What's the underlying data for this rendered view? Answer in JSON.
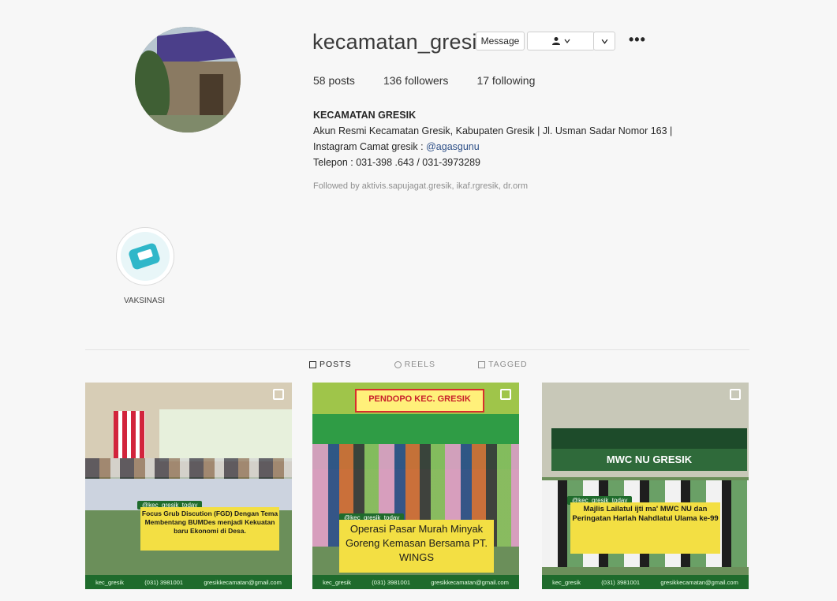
{
  "profile": {
    "username": "kecamatan_gresik",
    "message_label": "Message",
    "follow_icon": "person-icon",
    "more_label": "•••",
    "stats": {
      "posts": "58 posts",
      "followers": "136 followers",
      "following": "17 following"
    },
    "bio": {
      "name": "KECAMATAN GRESIK",
      "line1": "Akun Resmi Kecamatan Gresik, Kabupaten Gresik | Jl. Usman Sadar Nomor 163 |",
      "line2_prefix": "Instagram Camat gresik : ",
      "line2_link": "@agasgunu",
      "line3": "Telepon : 031-398 .643 / 031-3973289"
    },
    "followed_by": "Followed by aktivis.sapujagat.gresik, ikaf.rgresik, dr.orm"
  },
  "highlights": [
    {
      "label": "VAKSINASI"
    }
  ],
  "tabs": [
    {
      "label": "POSTS",
      "icon": "grid-icon",
      "active": true
    },
    {
      "label": "REELS",
      "icon": "reels-icon",
      "active": false
    },
    {
      "label": "TAGGED",
      "icon": "tag-icon",
      "active": false
    }
  ],
  "posts": [
    {
      "tag": "@kec_gresik_today",
      "caption": "Focus Grub Discution (FGD) Dengan Tema Membentang BUMDes menjadi Kekuatan baru Ekonomi di Desa.",
      "footer": [
        "kec_gresik",
        "(031) 3981001",
        "gresikkecamatan@gmail.com"
      ]
    },
    {
      "tag": "@kec_gresik_today",
      "title": "PENDOPO KEC. GRESIK",
      "caption": "Operasi Pasar Murah Minyak Goreng Kemasan Bersama PT. WINGS",
      "footer": [
        "kec_gresik",
        "(031) 3981001",
        "gresikkecamatan@gmail.com"
      ]
    },
    {
      "tag": "@kec_gresik_today",
      "banner_text": "MWC NU GRESIK",
      "caption": "Majlis Lailatul ijti ma' MWC NU dan Peringatan Harlah Nahdlatul Ulama ke-99",
      "footer": [
        "kec_gresik",
        "(031) 3981001",
        "gresikkecamatan@gmail.com"
      ]
    }
  ]
}
